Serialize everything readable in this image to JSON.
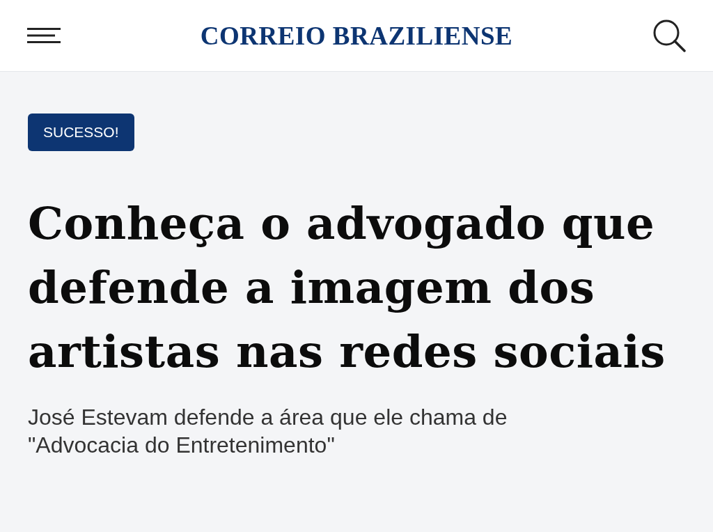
{
  "header": {
    "logo": "CORREIO BRAZILIENSE"
  },
  "article": {
    "badge": "SUCESSO!",
    "headline": "Conheça o advogado que defende a imagem dos artistas nas redes sociais",
    "subtitle": "José Estevam defende a área que ele chama de \"Advocacia do Entretenimento\""
  }
}
